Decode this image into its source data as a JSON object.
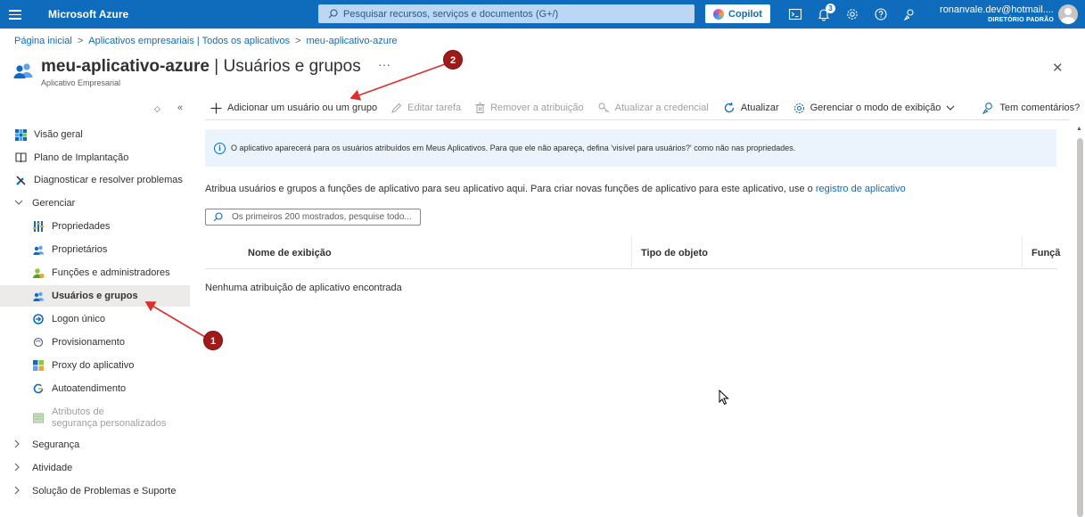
{
  "topbar": {
    "brand": "Microsoft Azure",
    "search_placeholder": "Pesquisar recursos, serviços e documentos (G+/)",
    "copilot_label": "Copilot",
    "notification_count": "3",
    "user_email": "ronanvale.dev@hotmail....",
    "user_directory": "DIRETÓRIO PADRÃO",
    "accent_color": "#0f6cbd"
  },
  "breadcrumb": {
    "items": [
      "Página inicial",
      "Aplicativos empresariais | Todos os aplicativos",
      "meu-aplicativo-azure"
    ],
    "separator": ">"
  },
  "header": {
    "title_app": "meu-aplicativo-azure",
    "title_separator": " | ",
    "title_section": "Usuários e grupos",
    "more_label": "···",
    "subtitle": "Aplicativo Empresarial",
    "close_label": "✕"
  },
  "sidebar": {
    "collapse_label": "«",
    "toggle_label": "◇",
    "items": [
      {
        "label": "Visão geral",
        "icon": "grid-icon"
      },
      {
        "label": "Plano de Implantação",
        "icon": "book-icon"
      },
      {
        "label": "Diagnosticar e resolver problemas",
        "icon": "wrench-icon"
      },
      {
        "label": "Gerenciar",
        "icon": "chevron-down-icon"
      },
      {
        "label": "Propriedades",
        "icon": "properties-icon"
      },
      {
        "label": "Proprietários",
        "icon": "users-icon"
      },
      {
        "label": "Funções e administradores",
        "icon": "roles-icon"
      },
      {
        "label": "Usuários e grupos",
        "icon": "users-icon"
      },
      {
        "label": "Logon único",
        "icon": "sso-icon"
      },
      {
        "label": "Provisionamento",
        "icon": "provisioning-icon"
      },
      {
        "label": "Proxy do aplicativo",
        "icon": "proxy-icon"
      },
      {
        "label": "Autoatendimento",
        "icon": "selfservice-icon"
      },
      {
        "label": "Atributos de",
        "label2": "segurança personalizados",
        "icon": "attributes-icon"
      },
      {
        "label": "Segurança",
        "icon": "chevron-right-icon"
      },
      {
        "label": "Atividade",
        "icon": "chevron-right-icon"
      },
      {
        "label": "Solução de Problemas e Suporte",
        "icon": "chevron-right-icon"
      }
    ]
  },
  "toolbar": {
    "add_label": "Adicionar um usuário ou um grupo",
    "edit_label": "Editar tarefa",
    "remove_label": "Remover a atribuição",
    "update_credential_label": "Atualizar a credencial",
    "refresh_label": "Atualizar",
    "view_mode_label": "Gerenciar o modo de exibição",
    "feedback_label": "Tem comentários?"
  },
  "banner": {
    "text": "O aplicativo aparecerá para os usuários atribuídos em Meus Aplicativos. Para que ele não apareça, defina 'visível para usuários?' como não nas propriedades."
  },
  "main": {
    "description": "Atribua usuários e grupos a funções de aplicativo para seu aplicativo aqui. Para criar novas funções de aplicativo para este aplicativo, use o ",
    "description_link": "registro de aplicativo",
    "filter_placeholder": "Os primeiros 200 mostrados, pesquise todo..."
  },
  "table": {
    "columns": [
      "Nome de exibição",
      "Tipo de objeto",
      "Funçã"
    ],
    "empty_message": "Nenhuma atribuição de aplicativo encontrada"
  },
  "annotations": {
    "marker1": "1",
    "marker2": "2",
    "color": "#a11a1a"
  }
}
